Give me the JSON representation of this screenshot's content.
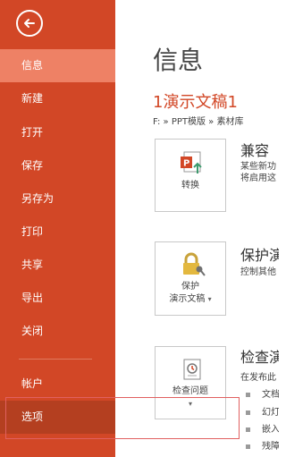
{
  "sidebar": {
    "items": [
      {
        "label": "信息"
      },
      {
        "label": "新建"
      },
      {
        "label": "打开"
      },
      {
        "label": "保存"
      },
      {
        "label": "另存为"
      },
      {
        "label": "打印"
      },
      {
        "label": "共享"
      },
      {
        "label": "导出"
      },
      {
        "label": "关闭"
      },
      {
        "label": "帐户"
      },
      {
        "label": "选项"
      }
    ],
    "selected": "信息"
  },
  "main": {
    "title": "信息",
    "doc_name": "1演示文稿1",
    "path": "F: » PPT模版 » 素材库",
    "sections": [
      {
        "title": "兼容",
        "desc": [
          "某些新功",
          "将启用这"
        ],
        "button_lines": [
          "转换"
        ]
      },
      {
        "title": "保护演",
        "desc": [
          "控制其他"
        ],
        "button_lines": [
          "保护",
          "演示文稿"
        ]
      },
      {
        "title": "检查演",
        "desc": [
          "在发布此"
        ],
        "button_lines": [
          "检查问题"
        ],
        "bullets": [
          "文档",
          "幻灯",
          "嵌入",
          "残障"
        ]
      }
    ]
  },
  "colors": {
    "sidebar_bg": "#d24726",
    "selected_item_bg": "#ee8165",
    "hover_item_bg": "#b43f20",
    "doc_name": "#d24726",
    "highlight_border": "#e06060"
  },
  "icons": {
    "back": "back-arrow-circle-icon",
    "convert": "powerpoint-convert-icon",
    "protect": "lock-key-icon",
    "inspect": "document-checklist-icon"
  }
}
